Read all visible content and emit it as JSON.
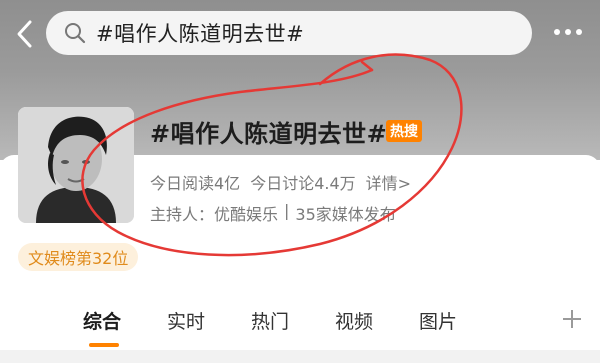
{
  "header": {
    "search_query": "#唱作人陈道明去世#",
    "icons": {
      "back": "chevron-left-icon",
      "search": "search-icon",
      "more": "more-dots-icon"
    }
  },
  "topic": {
    "title": "#唱作人陈道明去世#",
    "hot_badge": "热搜",
    "today_reads": "今日阅读4亿",
    "today_discussions": "今日讨论4.4万",
    "details_link": "详情>",
    "host_label": "主持人：优酷娱乐",
    "separator": "|",
    "media_count": "35家媒体发布",
    "rank_badge": "文娱榜第32位"
  },
  "tabs": {
    "items": [
      {
        "label": "综合",
        "active": true
      },
      {
        "label": "实时",
        "active": false
      },
      {
        "label": "热门",
        "active": false
      },
      {
        "label": "视频",
        "active": false
      },
      {
        "label": "图片",
        "active": false
      }
    ],
    "add_icon": "plus-icon"
  },
  "colors": {
    "accent": "#ff8200",
    "rank_bg": "#fdf0dc",
    "rank_text": "#e08b1c",
    "annotation": "#e53935"
  }
}
